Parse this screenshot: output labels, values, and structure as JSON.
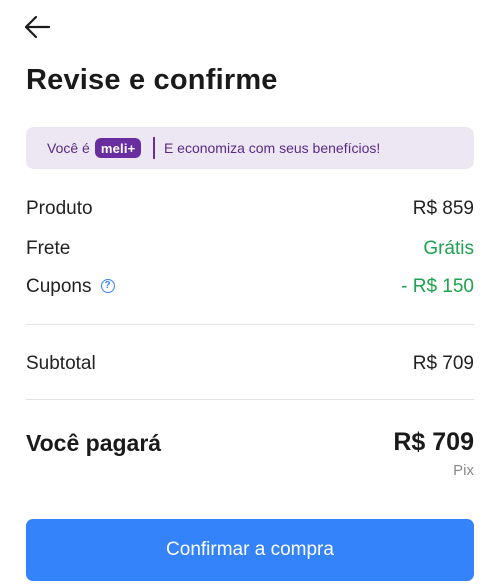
{
  "header": {
    "back_icon": "arrow-left-icon",
    "title": "Revise e confirme"
  },
  "meli_banner": {
    "prefix": "Você é",
    "badge": "meli+",
    "message": "E economiza com seus benefícios!"
  },
  "summary": {
    "product": {
      "label": "Produto",
      "value": "R$ 859"
    },
    "shipping": {
      "label": "Frete",
      "value": "Grátis"
    },
    "coupons": {
      "label": "Cupons",
      "value": "- R$ 150",
      "help_icon": "question-circle-icon"
    },
    "subtotal": {
      "label": "Subtotal",
      "value": "R$ 709"
    }
  },
  "total": {
    "label": "Você pagará",
    "value": "R$ 709",
    "method": "Pix"
  },
  "actions": {
    "confirm_label": "Confirmar a compra"
  },
  "colors": {
    "accent": "#3483fa",
    "success": "#1ea24f",
    "meli_purple": "#6a2da0",
    "banner_bg": "#ede7f4"
  }
}
